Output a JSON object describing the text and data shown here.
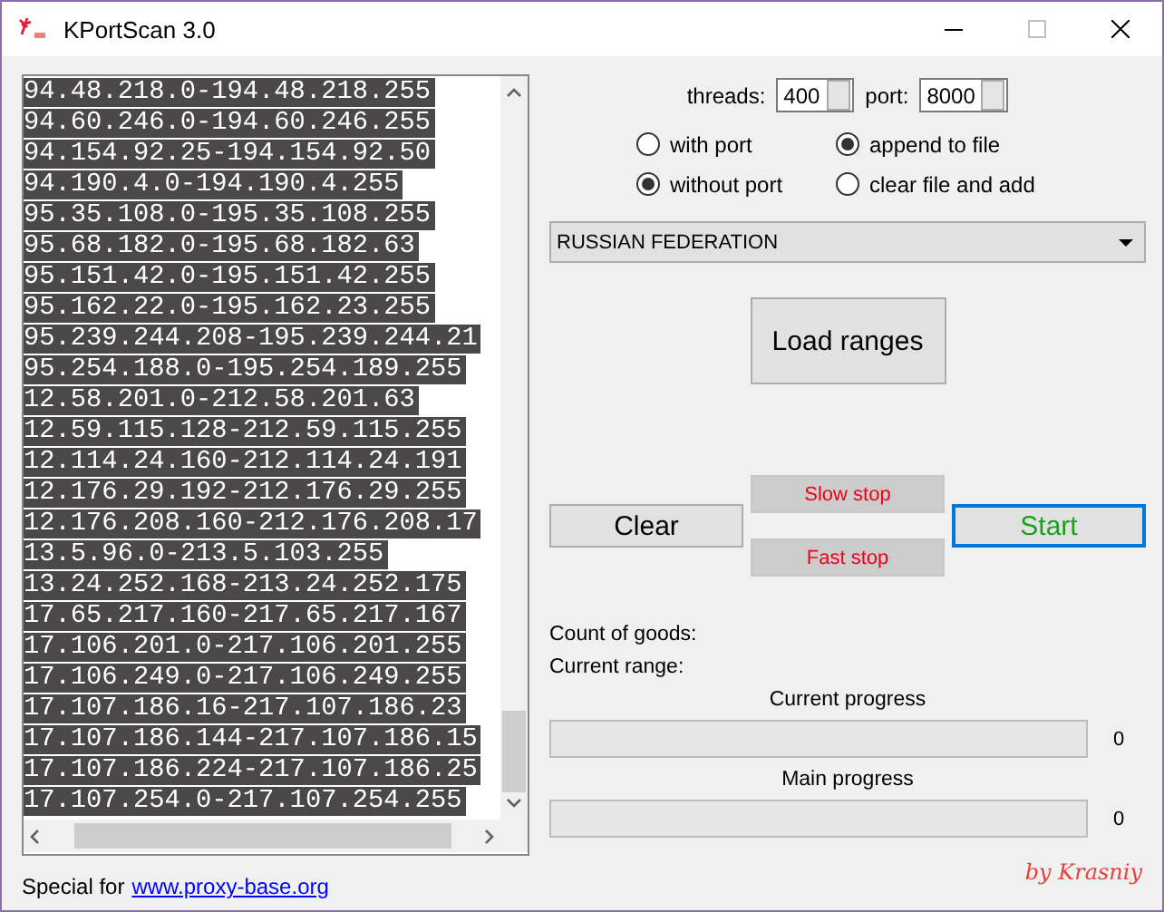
{
  "window": {
    "title": "KPortScan 3.0"
  },
  "ranges": [
    "94.48.218.0-194.48.218.255",
    "94.60.246.0-194.60.246.255",
    "94.154.92.25-194.154.92.50",
    "94.190.4.0-194.190.4.255",
    "95.35.108.0-195.35.108.255",
    "95.68.182.0-195.68.182.63",
    "95.151.42.0-195.151.42.255",
    "95.162.22.0-195.162.23.255",
    "95.239.244.208-195.239.244.21",
    "95.254.188.0-195.254.189.255",
    "12.58.201.0-212.58.201.63",
    "12.59.115.128-212.59.115.255",
    "12.114.24.160-212.114.24.191",
    "12.176.29.192-212.176.29.255",
    "12.176.208.160-212.176.208.17",
    "13.5.96.0-213.5.103.255",
    "13.24.252.168-213.24.252.175",
    "17.65.217.160-217.65.217.167",
    "17.106.201.0-217.106.201.255",
    "17.106.249.0-217.106.249.255",
    "17.107.186.16-217.107.186.23",
    "17.107.186.144-217.107.186.15",
    "17.107.186.224-217.107.186.25",
    "17.107.254.0-217.107.254.255"
  ],
  "threads": {
    "label": "threads:",
    "value": "400"
  },
  "port": {
    "label": "port:",
    "value": "8000"
  },
  "radio_rows": [
    [
      {
        "label": "with port",
        "selected": false
      },
      {
        "label": "append to file",
        "selected": true
      }
    ],
    [
      {
        "label": "without port",
        "selected": true
      },
      {
        "label": "clear file and add",
        "selected": false
      }
    ]
  ],
  "country": {
    "value": "RUSSIAN FEDERATION"
  },
  "load_button": "Load ranges",
  "clear_button": "Clear",
  "slow_stop_button": "Slow stop",
  "fast_stop_button": "Fast stop",
  "start_button": {
    "label": "Start",
    "focused": true
  },
  "count_label": "Count of goods:",
  "range_label": "Current range:",
  "progress": [
    {
      "title": "Current progress",
      "level": 0,
      "reading": "0"
    },
    {
      "title": "Main progress",
      "level": 0,
      "reading": "0"
    }
  ],
  "footer": {
    "text": "Special for",
    "link": "www.proxy-base.org",
    "credit": "by Krasniy"
  }
}
